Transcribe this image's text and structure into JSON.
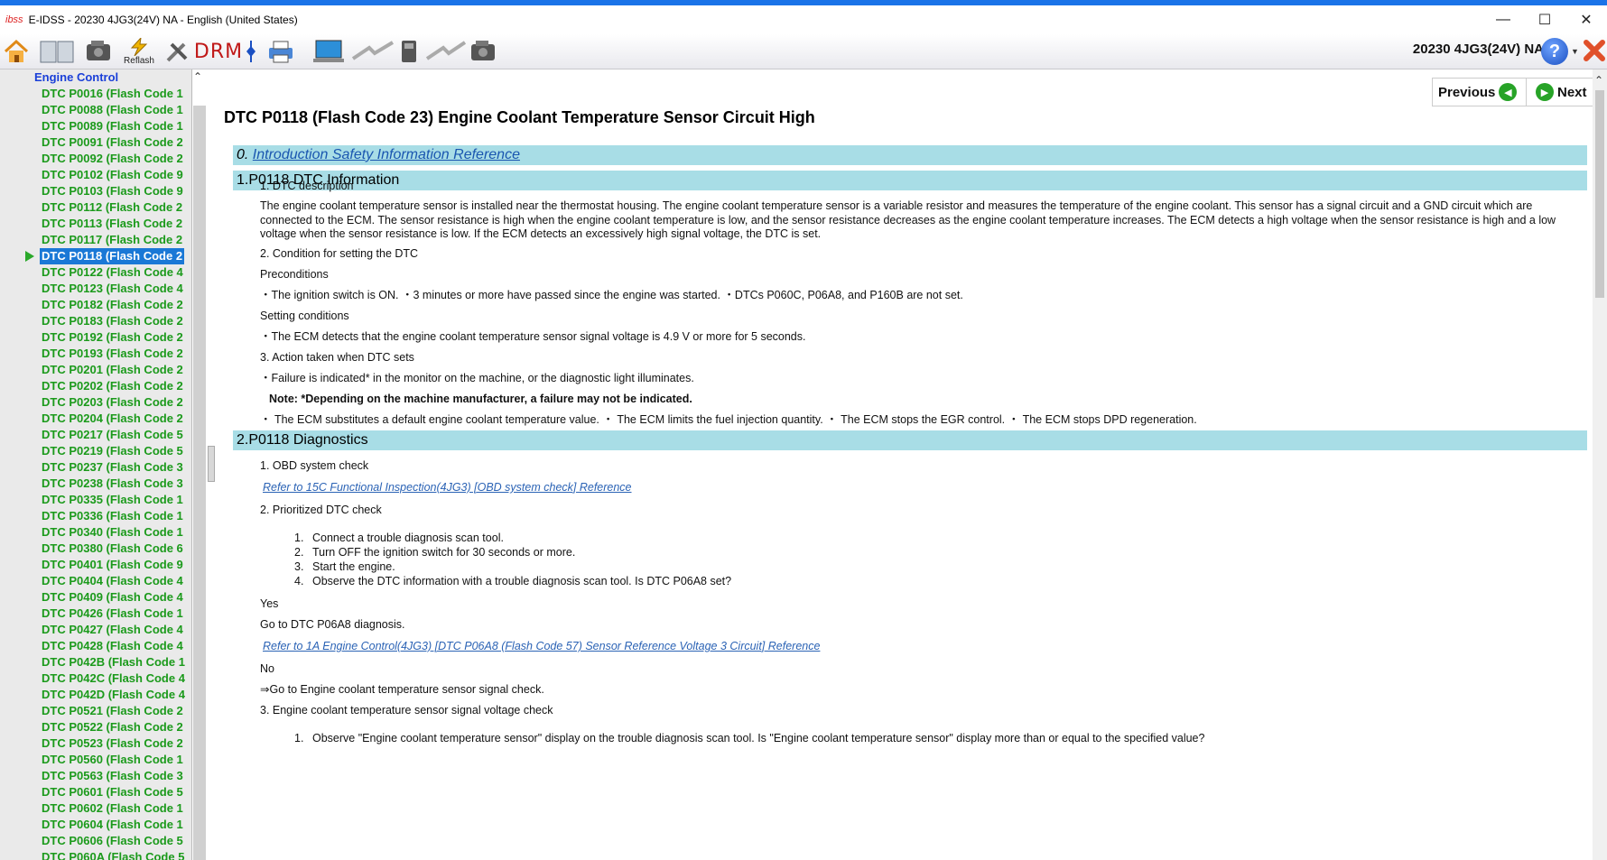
{
  "window": {
    "logo": "ibss",
    "title": "E-IDSS - 20230 4JG3(24V)  NA - English (United States)"
  },
  "toolbar": {
    "refresh_label": "Reflash",
    "drm_label": "DRM",
    "model_label": "20230 4JG3(24V)  NA",
    "help_label": "?"
  },
  "sidebar": {
    "header": "Engine Control",
    "items": [
      "DTC P0016 (Flash Code 1",
      "DTC P0088 (Flash Code 1",
      "DTC P0089 (Flash Code 1",
      "DTC P0091 (Flash Code 2",
      "DTC P0092 (Flash Code 2",
      "DTC P0102 (Flash Code 9",
      "DTC P0103 (Flash Code 9",
      "DTC P0112 (Flash Code 2",
      "DTC P0113 (Flash Code 2",
      "DTC P0117 (Flash Code 2",
      "DTC P0118 (Flash Code 2",
      "DTC P0122 (Flash Code 4",
      "DTC P0123 (Flash Code 4",
      "DTC P0182 (Flash Code 2",
      "DTC P0183 (Flash Code 2",
      "DTC P0192 (Flash Code 2",
      "DTC P0193 (Flash Code 2",
      "DTC P0201 (Flash Code 2",
      "DTC P0202 (Flash Code 2",
      "DTC P0203 (Flash Code 2",
      "DTC P0204 (Flash Code 2",
      "DTC P0217 (Flash Code 5",
      "DTC P0219 (Flash Code 5",
      "DTC P0237 (Flash Code 3",
      "DTC P0238 (Flash Code 3",
      "DTC P0335 (Flash Code 1",
      "DTC P0336 (Flash Code 1",
      "DTC P0340 (Flash Code 1",
      "DTC P0380 (Flash Code 6",
      "DTC P0401 (Flash Code 9",
      "DTC P0404 (Flash Code 4",
      "DTC P0409 (Flash Code 4",
      "DTC P0426 (Flash Code 1",
      "DTC P0427 (Flash Code 4",
      "DTC P0428 (Flash Code 4",
      "DTC P042B (Flash Code 1",
      "DTC P042C (Flash Code 4",
      "DTC P042D (Flash Code 4",
      "DTC P0521 (Flash Code 2",
      "DTC P0522 (Flash Code 2",
      "DTC P0523 (Flash Code 2",
      "DTC P0560 (Flash Code 1",
      "DTC P0563 (Flash Code 3",
      "DTC P0601 (Flash Code 5",
      "DTC P0602 (Flash Code 1",
      "DTC P0604 (Flash Code 1",
      "DTC P0606 (Flash Code 5",
      "DTC P060A (Flash Code 5"
    ],
    "active_index": 10
  },
  "nav": {
    "previous": "Previous",
    "next": "Next"
  },
  "doc": {
    "title": "DTC P0118 (Flash Code 23) Engine Coolant Temperature Sensor Circuit High",
    "section0_num": "0.",
    "section0_link": "Introduction Safety Information Reference",
    "section1": "1.P0118 DTC Information",
    "s1_dtc_desc": "1. DTC description",
    "s1_para": "The engine coolant temperature sensor is installed near the thermostat housing. The engine coolant temperature sensor is a variable resistor and measures the temperature of the engine coolant. This sensor has a signal circuit and a GND circuit which are connected to the ECM. The sensor resistance is high when the engine coolant temperature is low, and the sensor resistance decreases as the engine coolant temperature increases. The ECM detects a high voltage when the sensor resistance is high and a low voltage when the sensor resistance is low. If the ECM detects an excessively high signal voltage, the DTC is set.",
    "s1_cond": "2. Condition for setting the DTC",
    "s1_precond": "Preconditions",
    "s1_precond_text": "・The ignition switch is ON. ・3 minutes or more have passed since the engine was started. ・DTCs P060C, P06A8, and P160B are not set.",
    "s1_setting": "Setting conditions",
    "s1_setting_text": "・The ECM detects that the engine coolant temperature sensor signal voltage is 4.9 V or more for 5 seconds.",
    "s1_action": "3. Action taken when DTC sets",
    "s1_action_text": "・Failure is indicated* in the monitor on the machine, or the diagnostic light illuminates.",
    "s1_note": "Note: *Depending on the machine manufacturer, a failure may not be indicated.",
    "s1_ecm_text": "・ The ECM substitutes a default engine coolant temperature value. ・ The ECM limits the fuel injection quantity. ・ The ECM stops the EGR control. ・ The ECM stops DPD regeneration.",
    "section2": "2.P0118 Diagnostics",
    "s2_obd": "1. OBD system check",
    "s2_obd_link": "Refer to 15C Functional Inspection(4JG3) [OBD system check] Reference",
    "s2_prior": "2. Prioritized DTC check",
    "s2_steps": [
      "Connect a trouble diagnosis scan tool.",
      "Turn OFF the ignition switch for 30 seconds or more.",
      "Start the engine.",
      "Observe the DTC information with a trouble diagnosis scan tool. Is DTC P06A8 set?"
    ],
    "s2_yes": "Yes",
    "s2_goto": "Go to DTC P06A8 diagnosis.",
    "s2_ref_link": "Refer to 1A Engine Control(4JG3) [DTC P06A8 (Flash Code 57) Sensor Reference Voltage 3 Circuit] Reference",
    "s2_no": "No",
    "s2_no_text": "⇒Go to Engine coolant temperature sensor signal check.",
    "s2_ect": "3. Engine coolant temperature sensor signal voltage check",
    "s2_ect_step": "Observe \"Engine coolant temperature sensor\" display on the trouble diagnosis scan tool. Is \"Engine coolant temperature sensor\" display more than or equal to the specified value?"
  },
  "colors": {
    "accent": "#1a73e8",
    "band": "#a8dde6",
    "sidebar_text": "#1b9a1b",
    "link": "#2b63b5"
  }
}
